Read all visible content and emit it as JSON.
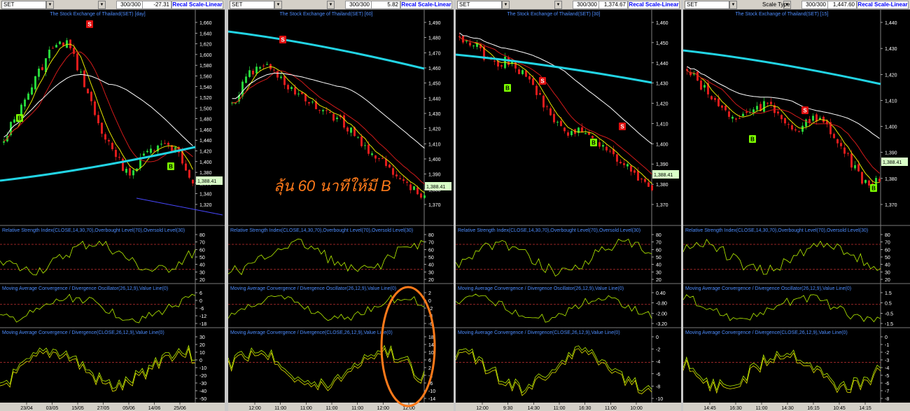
{
  "panels": [
    {
      "symbol": "SET",
      "bars": "300/300",
      "value": "-27.31",
      "scale_type": "",
      "recal": "Recal Scale-Linear",
      "chart_title": "The Stock Exchange of Thailand(SET) [day]",
      "price_ticks": [
        "1,660",
        "1,640",
        "1,620",
        "1,600",
        "1,580",
        "1,560",
        "1,540",
        "1,520",
        "1,500",
        "1,480",
        "1,460",
        "1,440",
        "1,420",
        "1,400",
        "1,380",
        "1,360",
        "1,340",
        "1,320"
      ],
      "last_price": "1,388.41",
      "rsi_title": "Relative Strength Index(CLOSE,14,30,70),Overbought Level(70),Oversold Level(30)",
      "rsi_ticks": [
        "80",
        "70",
        "60",
        "50",
        "40",
        "30",
        "20"
      ],
      "osc_title": "Moving Average Convergence / Divergence Oscillator(26,12,9),Value Line(0)",
      "osc_ticks": [
        "6",
        "0",
        "-6",
        "-12",
        "-18"
      ],
      "macd_title": "Moving Average Convergence / Divergence(CLOSE,26,12,9),Value Line(0)",
      "macd_ticks": [
        "30",
        "20",
        "10",
        "0",
        "-10",
        "-20",
        "-30",
        "-40",
        "-50"
      ],
      "time_ticks": [
        "23/04",
        "03/05",
        "15/05",
        "27/05",
        "05/06",
        "14/06",
        "25/06"
      ],
      "signals": [
        {
          "label": "S",
          "kind": "sell"
        },
        {
          "label": "B",
          "kind": "buy"
        },
        {
          "label": "B",
          "kind": "buy"
        }
      ]
    },
    {
      "symbol": "SET",
      "bars": "300/300",
      "value": "5.82",
      "scale_type": "",
      "recal": "Recal Scale-Linear",
      "chart_title": "The Stock Exchange of Thailand(SET) [60]",
      "price_ticks": [
        "1,490",
        "1,480",
        "1,470",
        "1,460",
        "1,450",
        "1,440",
        "1,430",
        "1,420",
        "1,410",
        "1,400",
        "1,390",
        "1,380",
        "1,370"
      ],
      "last_price": "1,388.41",
      "rsi_title": "Relative Strength Index(CLOSE,14,30,70),Overbought Level(70),Oversold Level(30)",
      "rsi_ticks": [
        "80",
        "70",
        "60",
        "50",
        "40",
        "30",
        "20"
      ],
      "osc_title": "Moving Average Convergence / Divergence Oscillator(26,12,9),Value Line(0)",
      "osc_ticks": [
        "2",
        "0",
        "-2",
        "-4",
        "-6"
      ],
      "macd_title": "Moving Average Convergence / Divergence(CLOSE,26,12,9),Value Line(0)",
      "macd_ticks": [
        "18",
        "14",
        "10",
        "6",
        "2",
        "-2",
        "-6",
        "-10",
        "-14"
      ],
      "time_ticks": [
        "12:00",
        "11:00",
        "11:00",
        "11:00",
        "11:00",
        "12:00",
        "12:00"
      ],
      "signals": [
        {
          "label": "S",
          "kind": "sell"
        }
      ],
      "annotation": "ลุ้น 60 นาทีให้มี B"
    },
    {
      "symbol": "SET",
      "bars": "300/300",
      "value": "1,374.67",
      "scale_type": "",
      "recal": "Recal Scale-Linear",
      "chart_title": "The Stock Exchange of Thailand(SET) [30]",
      "price_ticks": [
        "1,460",
        "1,450",
        "1,440",
        "1,430",
        "1,420",
        "1,410",
        "1,400",
        "1,390",
        "1,380",
        "1,370"
      ],
      "last_price": "1,388.41",
      "rsi_title": "Relative Strength Index(CLOSE,14,30,70),Overbought Level(70),Oversold Level(30)",
      "rsi_ticks": [
        "80",
        "70",
        "60",
        "50",
        "40",
        "30",
        "20"
      ],
      "osc_title": "Moving Average Convergence / Divergence Oscillator(26,12,9),Value Line(0)",
      "osc_ticks": [
        "0.40",
        "-0.80",
        "-2.00",
        "-3.20"
      ],
      "macd_title": "Moving Average Convergence / Divergence(CLOSE,26,12,9),Value Line(0)",
      "macd_ticks": [
        "0",
        "-2",
        "-4",
        "-6",
        "-8",
        "-10"
      ],
      "time_ticks": [
        "12:00",
        "9:30",
        "14:30",
        "11:00",
        "16:30",
        "11:00",
        "10:00"
      ],
      "signals": [
        {
          "label": "B",
          "kind": "buy"
        },
        {
          "label": "S",
          "kind": "sell"
        },
        {
          "label": "B",
          "kind": "buy"
        },
        {
          "label": "S",
          "kind": "sell"
        }
      ]
    },
    {
      "symbol": "SET",
      "bars": "300/300",
      "value": "1,447.60",
      "scale_type": "Scale Type",
      "recal": "Recal Scale-Linear",
      "chart_title": "The Stock Exchange of Thailand(SET) [15]",
      "price_ticks": [
        "1,440",
        "1,430",
        "1,420",
        "1,410",
        "1,400",
        "1,390",
        "1,380",
        "1,370"
      ],
      "last_price": "1,388.41",
      "rsi_title": "Relative Strength Index(CLOSE,14,30,70),Overbought Level(70),Oversold Level(30)",
      "rsi_ticks": [
        "80",
        "70",
        "60",
        "50",
        "40",
        "30",
        "20"
      ],
      "osc_title": "Moving Average Convergence / Divergence Oscillator(26,12,9),Value Line(0)",
      "osc_ticks": [
        "1.5",
        "0.5",
        "-0.5",
        "-1.5"
      ],
      "macd_title": "Moving Average Convergence / Divergence(CLOSE,26,12,9),Value Line(0)",
      "macd_ticks": [
        "0",
        "-1",
        "-2",
        "-3",
        "-4",
        "-5",
        "-6",
        "-7",
        "-8"
      ],
      "time_ticks": [
        "14:45",
        "16:30",
        "11:00",
        "14:30",
        "16:15",
        "10:45",
        "14:15"
      ],
      "signals": [
        {
          "label": "S",
          "kind": "sell"
        },
        {
          "label": "B",
          "kind": "buy"
        },
        {
          "label": "B",
          "kind": "buy"
        }
      ]
    }
  ],
  "colors": {
    "background": "#000000",
    "title_text": "#4d8dff",
    "axis_text": "#ffffff",
    "candle_up": "#27d63a",
    "candle_down": "#e01c1c",
    "ma_fast": "#e6e600",
    "ma_mid": "#d11a1a",
    "ma_slow": "#ffffff",
    "ma_long": "#22d4e4",
    "indicator": "#b6f000",
    "level_line": "#c83232",
    "buy": "#7cfc00",
    "sell": "#e01010",
    "last_price_box": "#d9ffc8",
    "annotation": "#ff7a1a"
  }
}
